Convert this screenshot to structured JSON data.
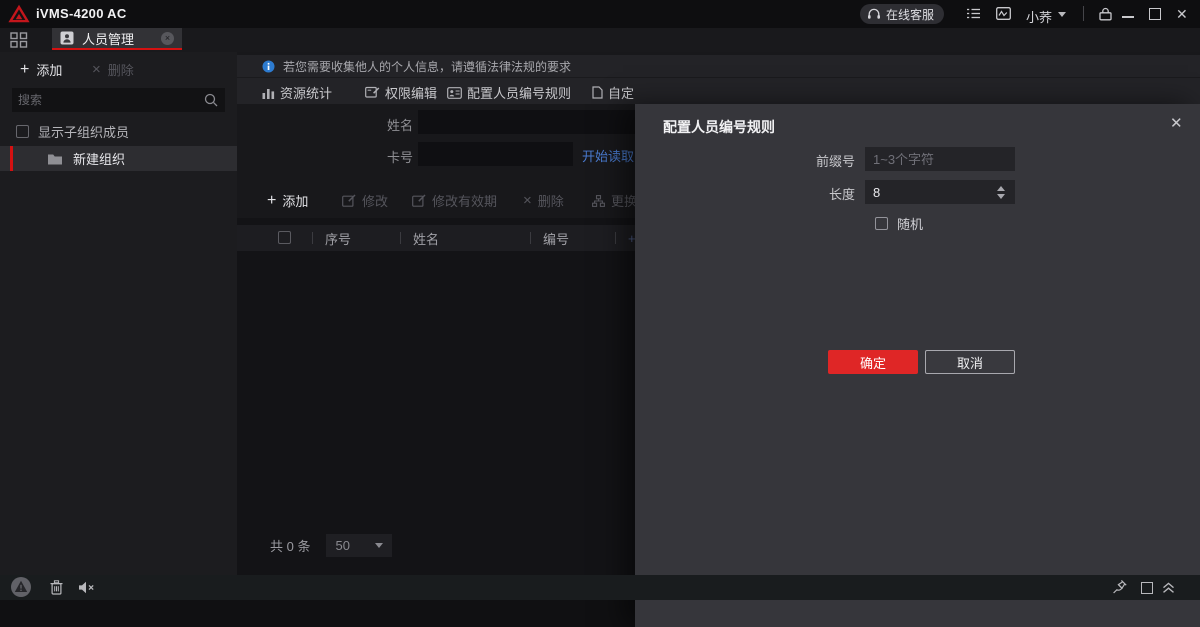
{
  "icons": {
    "plus": "+",
    "x": "×",
    "close": "✕"
  },
  "titlebar": {
    "app_title": "iVMS-4200 AC",
    "support_label": "在线客服",
    "username": "小荞"
  },
  "tabbar": {
    "active_tab": "人员管理"
  },
  "sidebar": {
    "add_label": "添加",
    "delete_label": "删除",
    "search_placeholder": "搜索",
    "show_sub_members_label": "显示子组织成员",
    "org_name": "新建组织"
  },
  "main": {
    "info_text": "若您需要收集他人的个人信息，请遵循法律法规的要求",
    "toolbar": {
      "resource_stats": "资源统计",
      "permission_edit": "权限编辑",
      "configure_id_rule": "配置人员编号规则",
      "custom": "自定"
    },
    "form": {
      "name_label": "姓名",
      "card_label": "卡号",
      "read_link": "开始读取"
    },
    "table_toolbar": {
      "add": "添加",
      "modify": "修改",
      "modify_validity": "修改有效期",
      "delete": "删除",
      "change_org": "更换"
    },
    "table": {
      "col_index": "序号",
      "col_name": "姓名",
      "col_id": "编号",
      "col_extra": "+"
    },
    "pagination": {
      "total_label": "共 0 条",
      "page_size": "50"
    }
  },
  "dialog": {
    "title": "配置人员编号规则",
    "prefix_label": "前缀号",
    "prefix_placeholder": "1~3个字符",
    "length_label": "长度",
    "length_value": "8",
    "random_label": "随机",
    "ok_label": "确定",
    "cancel_label": "取消"
  },
  "colors": {
    "accent_red": "#d41111",
    "link_blue": "#4a7bd0"
  }
}
